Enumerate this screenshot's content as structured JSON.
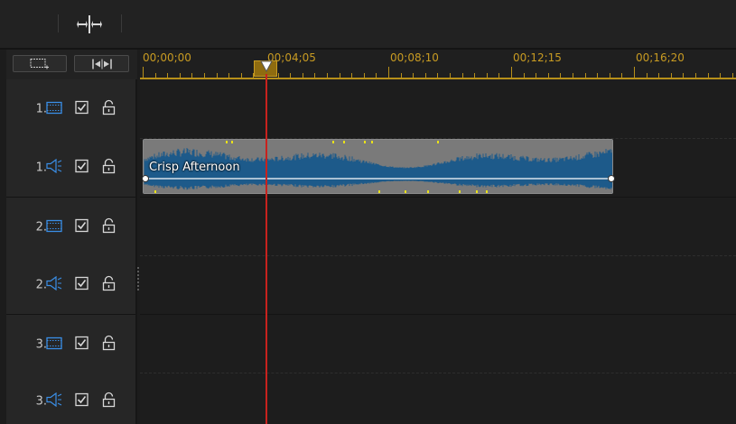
{
  "ruler": {
    "labels": [
      "00;00;00",
      "00;04;05",
      "00;08;10",
      "00;12;15",
      "00;16;20"
    ]
  },
  "tracks": [
    {
      "number": "1.",
      "kind": "video"
    },
    {
      "number": "1.",
      "kind": "audio"
    },
    {
      "number": "2.",
      "kind": "video"
    },
    {
      "number": "2.",
      "kind": "audio"
    },
    {
      "number": "3.",
      "kind": "video"
    },
    {
      "number": "3.",
      "kind": "audio"
    }
  ],
  "clip": {
    "title": "Crisp Afternoon",
    "track": "1. audio"
  },
  "colors": {
    "accent": "#c89b22",
    "playhead": "#c8221e",
    "waveform": "#1d5a8a",
    "icon_blue": "#3a8ee6"
  },
  "icons": {
    "toolbar": "split-icon",
    "header_left": "add-track-icon",
    "header_right": "fit-timeline-icon",
    "video_track": "film-icon",
    "audio_track": "speaker-icon",
    "enable": "checkbox-icon",
    "lock": "unlock-icon"
  }
}
